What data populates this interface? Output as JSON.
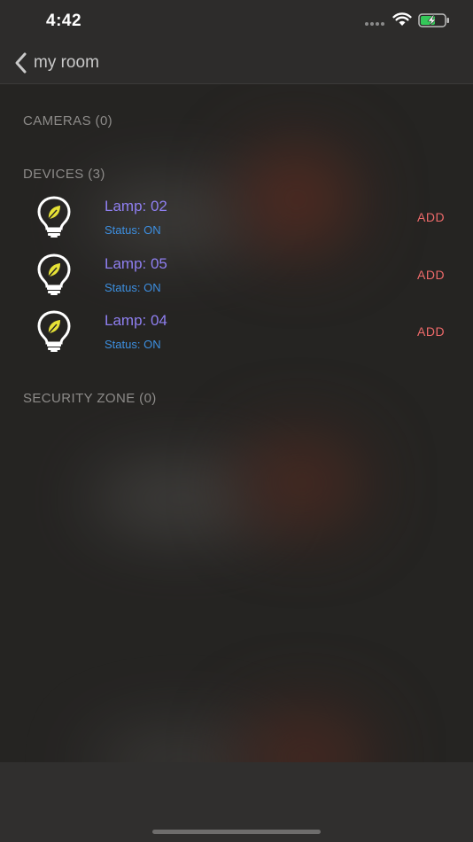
{
  "status_bar": {
    "time": "4:42"
  },
  "nav": {
    "back_label": "my room"
  },
  "sections": [
    {
      "header": "CAMERAS (0)"
    },
    {
      "header": "DEVICES (3)"
    },
    {
      "header": "SECURITY ZONE (0)"
    }
  ],
  "devices": [
    {
      "name": "Lamp: 02",
      "status": "Status: ON",
      "action": "ADD"
    },
    {
      "name": "Lamp: 05",
      "status": "Status: ON",
      "action": "ADD"
    },
    {
      "name": "Lamp: 04",
      "status": "Status: ON",
      "action": "ADD"
    }
  ],
  "colors": {
    "background": "#2a2827",
    "device_name": "#8f7ff0",
    "device_status": "#3d8fe0",
    "add_action": "#ee6a6a",
    "section_header": "#8d8b89"
  }
}
